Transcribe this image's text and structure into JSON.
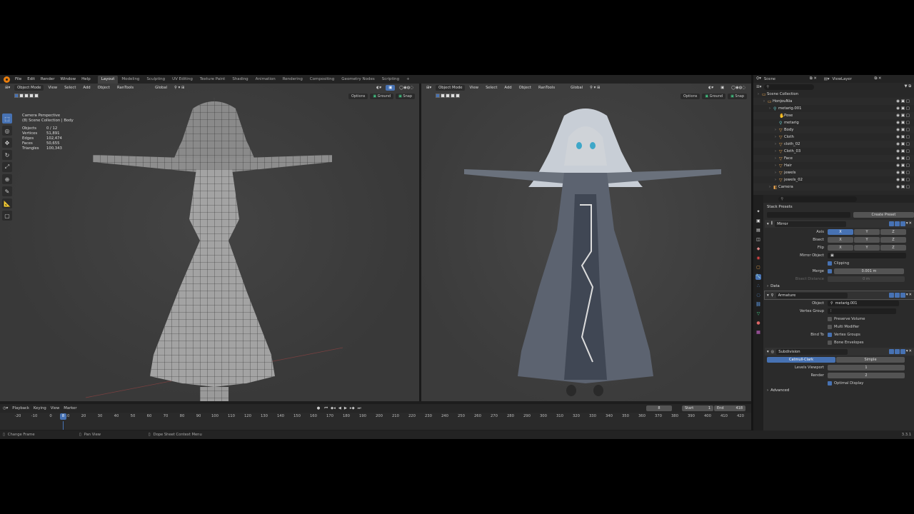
{
  "topbar": {
    "menus": [
      "File",
      "Edit",
      "Render",
      "Window",
      "Help"
    ],
    "tabs": [
      "Layout",
      "Modeling",
      "Sculpting",
      "UV Editing",
      "Texture Paint",
      "Shading",
      "Animation",
      "Rendering",
      "Compositing",
      "Geometry Nodes",
      "Scripting"
    ],
    "active_tab": "Layout",
    "add_tab": "+"
  },
  "viewport_left": {
    "mode": "Object Mode",
    "menus": [
      "View",
      "Select",
      "Add",
      "Object",
      "RanTools"
    ],
    "orientation": "Global",
    "options": "Options",
    "ground": "Ground",
    "snap": "Snap",
    "info_title": "Camera Perspective",
    "info_sub": "(8) Scene Collection | Body",
    "stats": [
      {
        "label": "Objects",
        "value": "0 / 12"
      },
      {
        "label": "Vertices",
        "value": "51,891"
      },
      {
        "label": "Edges",
        "value": "102,474"
      },
      {
        "label": "Faces",
        "value": "50,655"
      },
      {
        "label": "Triangles",
        "value": "100,343"
      }
    ]
  },
  "viewport_right": {
    "mode": "Object Mode",
    "menus": [
      "View",
      "Select",
      "Add",
      "Object",
      "RanTools"
    ],
    "orientation": "Global",
    "options": "Options",
    "ground": "Ground",
    "snap": "Snap"
  },
  "outliner": {
    "scene": "Scene",
    "view_layer": "ViewLayer",
    "items": [
      {
        "label": "Scene Collection",
        "icon": "collection-icon",
        "depth": 0
      },
      {
        "label": "HonjouNia",
        "icon": "collection-icon",
        "depth": 1
      },
      {
        "label": "metarig.001",
        "icon": "armature-icon",
        "depth": 2
      },
      {
        "label": "Pose",
        "icon": "pose-icon",
        "depth": 3
      },
      {
        "label": "metarig",
        "icon": "armature-icon",
        "depth": 3
      },
      {
        "label": "Body",
        "icon": "mesh-icon",
        "depth": 3
      },
      {
        "label": "Cloth",
        "icon": "mesh-icon",
        "depth": 3
      },
      {
        "label": "cloth_02",
        "icon": "mesh-icon",
        "depth": 3
      },
      {
        "label": "Cloth_03",
        "icon": "mesh-icon",
        "depth": 3
      },
      {
        "label": "Face",
        "icon": "mesh-icon",
        "depth": 3
      },
      {
        "label": "Hair",
        "icon": "mesh-icon",
        "depth": 3
      },
      {
        "label": "jewels",
        "icon": "mesh-icon",
        "depth": 3
      },
      {
        "label": "jewels_02",
        "icon": "mesh-icon",
        "depth": 3
      },
      {
        "label": "Camera",
        "icon": "camera-icon",
        "depth": 2
      }
    ]
  },
  "properties": {
    "stack_presets": "Stack Presets",
    "create_preset": "Create Preset",
    "mirror": {
      "name": "Mirror",
      "axis_label": "Axis",
      "bisect_label": "Bisect",
      "flip_label": "Flip",
      "axes": [
        "X",
        "Y",
        "Z"
      ],
      "mirror_object_label": "Mirror Object",
      "clipping": "Clipping",
      "merge_label": "Merge",
      "merge_value": "0.001 m",
      "bisect_distance_label": "Bisect Distance",
      "bisect_distance_value": "0 m",
      "data": "Data"
    },
    "armature": {
      "name": "Armature",
      "object_label": "Object",
      "object_value": "metarig.001",
      "vertex_group_label": "Vertex Group",
      "preserve_volume": "Preserve Volume",
      "multi_modifier": "Multi Modifier",
      "bind_to_label": "Bind To",
      "vertex_groups": "Vertex Groups",
      "bone_envelopes": "Bone Envelopes"
    },
    "subdivision": {
      "name": "Subdivision",
      "catmull": "Catmull-Clark",
      "simple": "Simple",
      "levels_viewport_label": "Levels Viewport",
      "levels_viewport": "1",
      "render_label": "Render",
      "render": "2",
      "optimal_display": "Optimal Display",
      "advanced": "Advanced"
    }
  },
  "timeline": {
    "menus": [
      "Playback",
      "Keying",
      "View",
      "Marker"
    ],
    "current_frame": "8",
    "start_label": "Start",
    "start": "1",
    "end_label": "End",
    "end": "418",
    "ticks": [
      "-20",
      "-10",
      "0",
      "10",
      "20",
      "30",
      "40",
      "50",
      "60",
      "70",
      "80",
      "90",
      "100",
      "110",
      "120",
      "130",
      "140",
      "150",
      "160",
      "170",
      "180",
      "190",
      "200",
      "210",
      "220",
      "230",
      "240",
      "250",
      "260",
      "270",
      "280",
      "290",
      "300",
      "310",
      "320",
      "330",
      "340",
      "350",
      "360",
      "370",
      "380",
      "390",
      "400",
      "410",
      "420"
    ]
  },
  "statusbar": {
    "change_frame": "Change Frame",
    "pan_view": "Pan View",
    "context_menu": "Dope Sheet Context Menu",
    "version": "3.3.1"
  },
  "colors": {
    "accent": "#4772b3",
    "orange": "#e87d0d",
    "bg": "#1d1d1d"
  }
}
